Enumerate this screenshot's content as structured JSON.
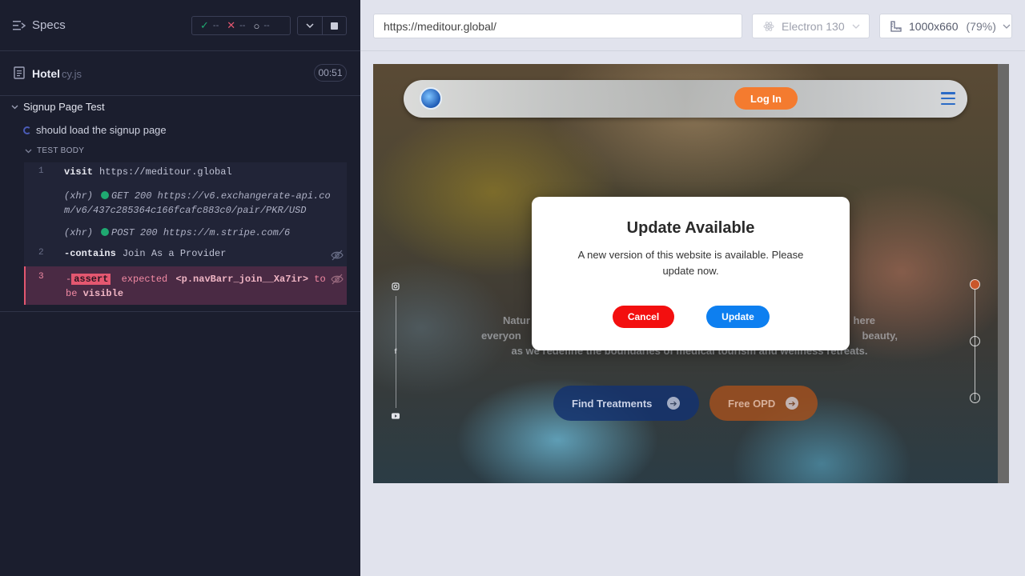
{
  "reporter": {
    "specs_label": "Specs",
    "stats": {
      "passed": "--",
      "failed": "--",
      "pending": "--"
    },
    "file": {
      "name": "Hotel",
      "ext": "cy.js",
      "duration": "00:51"
    },
    "suite_title": "Signup Page Test",
    "test_title": "should load the signup page",
    "test_body_label": "TEST BODY",
    "commands": [
      {
        "num": "1",
        "name": "visit",
        "value": "https://meditour.global"
      },
      {
        "tag": "(xhr)",
        "text": "GET 200 https://v6.exchangerate-api.com/v6/437c285364c166fcafc883c0/pair/PKR/USD"
      },
      {
        "tag": "(xhr)",
        "text": "POST 200 https://m.stripe.com/6"
      },
      {
        "num": "2",
        "name": "-contains",
        "value": "Join As a Provider"
      },
      {
        "num": "3",
        "name": "assert",
        "prefix": "-",
        "expected": "expected",
        "selector": "<p.navBarr_join__Xa7ir>",
        "to": "to",
        "be": "be",
        "visible": "visible"
      }
    ]
  },
  "toolbar": {
    "url": "https://meditour.global/",
    "browser": "Electron 130",
    "viewport": "1000x660",
    "scale": "(79%)"
  },
  "site": {
    "login_label": "Log In",
    "hero_line1_left": "Natur",
    "hero_line1_right": "here",
    "hero_line2_left": "everyon",
    "hero_line2_right": "beauty,",
    "hero_line3": "as we redefine the boundaries of medical tourism and wellness retreats.",
    "find_label": "Find Treatments",
    "opd_label": "Free OPD"
  },
  "modal": {
    "title": "Update Available",
    "message": "A new version of this website is available. Please update now.",
    "cancel_label": "Cancel",
    "update_label": "Update"
  },
  "colors": {
    "reporter_bg": "#1b1e2e",
    "login_orange": "#f47b2f",
    "cancel_red": "#f30f0f",
    "update_blue": "#0d7ff0",
    "fail_pink": "#e45770",
    "pass_green": "#1fa971"
  }
}
